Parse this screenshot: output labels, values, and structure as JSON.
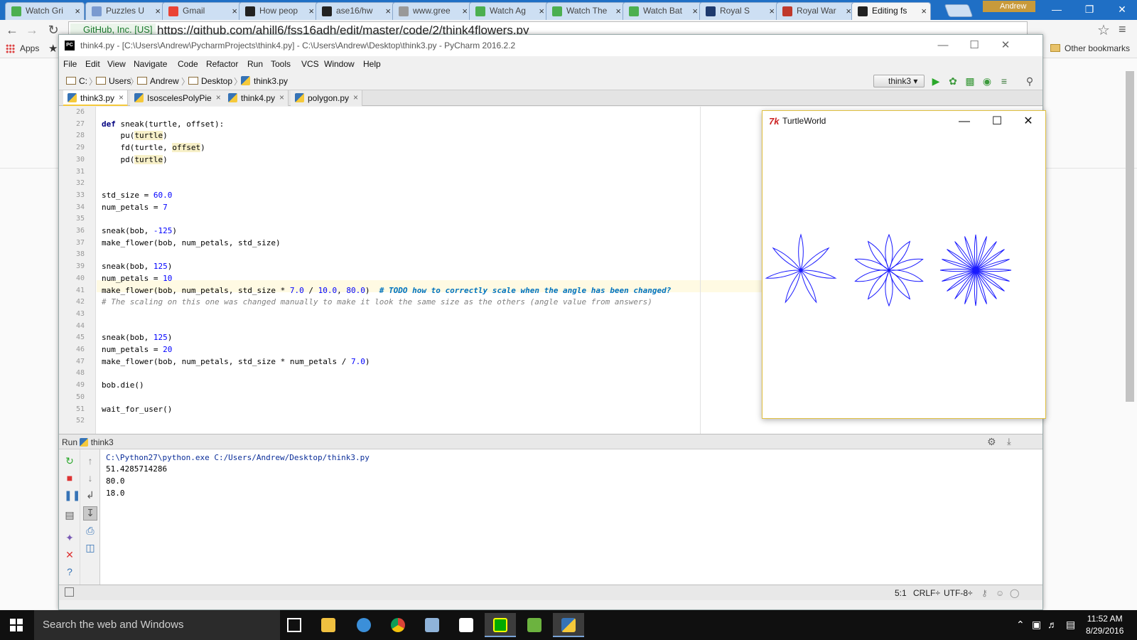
{
  "browser": {
    "tabs": [
      {
        "label": "Watch Gri",
        "fav": "h",
        "color": "#4caf50"
      },
      {
        "label": "Puzzles U",
        "fav": "doc",
        "color": "#7a9ad0"
      },
      {
        "label": "Gmail",
        "fav": "G",
        "color": "#ea4335"
      },
      {
        "label": "How peop",
        "fav": "gh",
        "color": "#222222"
      },
      {
        "label": "ase16/hw",
        "fav": "gh",
        "color": "#222222"
      },
      {
        "label": "www.gree",
        "fav": "doc",
        "color": "#999999"
      },
      {
        "label": "Watch Ag",
        "fav": "h",
        "color": "#4caf50"
      },
      {
        "label": "Watch The",
        "fav": "h",
        "color": "#4caf50"
      },
      {
        "label": "Watch Bat",
        "fav": "h",
        "color": "#4caf50"
      },
      {
        "label": "Royal S",
        "fav": "shield",
        "color": "#1e3a6e"
      },
      {
        "label": "Royal War",
        "fav": "cr",
        "color": "#c0392b"
      },
      {
        "label": "Editing fs",
        "fav": "gh",
        "color": "#222222"
      }
    ],
    "profile": "Andrew",
    "secure_label": "GitHub, Inc. [US]",
    "url": "https://github.com/ahill6/fss16adh/edit/master/code/2/think4flowers.py",
    "bookmarks": {
      "apps": "Apps",
      "other": "Other bookmarks"
    }
  },
  "pycharm": {
    "title": "think4.py - [C:\\Users\\Andrew\\PycharmProjects\\think4.py] - C:\\Users\\Andrew\\Desktop\\think3.py - PyCharm 2016.2.2",
    "menu": [
      "File",
      "Edit",
      "View",
      "Navigate",
      "Code",
      "Refactor",
      "Run",
      "Tools",
      "VCS",
      "Window",
      "Help"
    ],
    "breadcrumbs": [
      "C:",
      "Users",
      "Andrew",
      "Desktop",
      "think3.py"
    ],
    "run_config": "think3",
    "tabs": [
      {
        "label": "think3.py",
        "active": true
      },
      {
        "label": "IsoscelesPolyPie",
        "active": false
      },
      {
        "label": "think4.py",
        "active": false
      },
      {
        "label": "polygon.py",
        "active": false
      }
    ],
    "code_lines": [
      {
        "n": "26",
        "t": ""
      },
      {
        "n": "27",
        "t": "def sneak(turtle, offset):"
      },
      {
        "n": "28",
        "t": "    pu(turtle)"
      },
      {
        "n": "29",
        "t": "    fd(turtle, offset)"
      },
      {
        "n": "30",
        "t": "    pd(turtle)"
      },
      {
        "n": "31",
        "t": ""
      },
      {
        "n": "32",
        "t": ""
      },
      {
        "n": "33",
        "t": "std_size = 60.0"
      },
      {
        "n": "34",
        "t": "num_petals = 7"
      },
      {
        "n": "35",
        "t": ""
      },
      {
        "n": "36",
        "t": "sneak(bob, -125)"
      },
      {
        "n": "37",
        "t": "make_flower(bob, num_petals, std_size)"
      },
      {
        "n": "38",
        "t": ""
      },
      {
        "n": "39",
        "t": "sneak(bob, 125)"
      },
      {
        "n": "40",
        "t": "num_petals = 10"
      },
      {
        "n": "41",
        "t": "make_flower(bob, num_petals, std_size * 7.0 / 10.0, 80.0)  # TODO how to correctly scale when the angle has been changed?"
      },
      {
        "n": "42",
        "t": "# The scaling on this one was changed manually to make it look the same size as the others (angle value from answers)"
      },
      {
        "n": "43",
        "t": ""
      },
      {
        "n": "44",
        "t": ""
      },
      {
        "n": "45",
        "t": "sneak(bob, 125)"
      },
      {
        "n": "46",
        "t": "num_petals = 20"
      },
      {
        "n": "47",
        "t": "make_flower(bob, num_petals, std_size * num_petals / 7.0)"
      },
      {
        "n": "48",
        "t": ""
      },
      {
        "n": "49",
        "t": "bob.die()"
      },
      {
        "n": "50",
        "t": ""
      },
      {
        "n": "51",
        "t": "wait_for_user()"
      },
      {
        "n": "52",
        "t": ""
      }
    ],
    "run_panel": {
      "title": "Run",
      "config": "think3",
      "output": [
        "C:\\Python27\\python.exe C:/Users/Andrew/Desktop/think3.py",
        "51.4285714286",
        "80.0",
        "18.0"
      ]
    },
    "status": {
      "position": "5:1",
      "line_sep": "CRLF÷",
      "encoding": "UTF-8÷"
    }
  },
  "turtle_world": {
    "title": "TurtleWorld",
    "flower_color": "#1a1aff",
    "flowers": [
      {
        "petals": 7,
        "angle": 51.4285714286
      },
      {
        "petals": 10,
        "angle": 80.0
      },
      {
        "petals": 20,
        "angle": 18.0
      }
    ]
  },
  "taskbar": {
    "search_placeholder": "Search the web and Windows",
    "time": "11:52 AM",
    "date": "8/29/2016"
  }
}
